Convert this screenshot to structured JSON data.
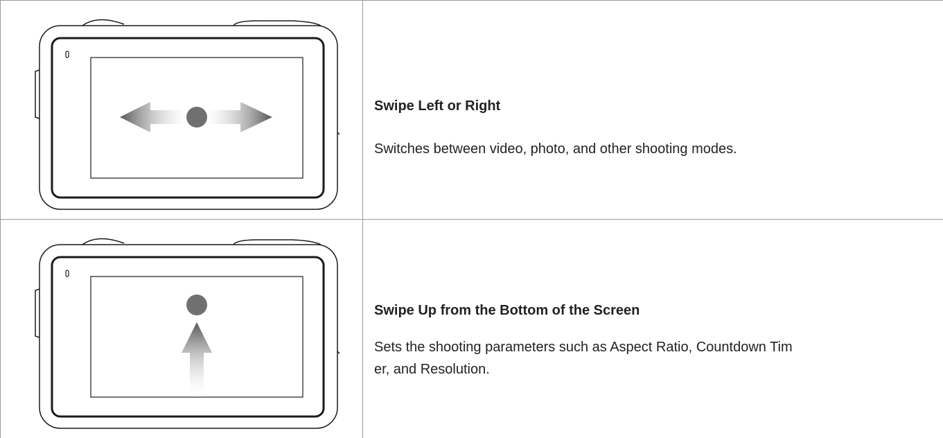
{
  "gestures": [
    {
      "title": "Swipe Left or Right",
      "description": "Switches between video, photo, and other shooting modes.",
      "illustration": "camera-swipe-left-right-icon"
    },
    {
      "title": "Swipe Up from the Bottom of the Screen",
      "description": "Sets the shooting parameters such as Aspect Ratio, Countdown Tim\ner, and Resolution.",
      "illustration": "camera-swipe-up-icon"
    }
  ],
  "colors": {
    "border": "#9a9a9a",
    "text": "#222222",
    "device_outline": "#1a1a1a",
    "gesture_dot": "#707070"
  }
}
